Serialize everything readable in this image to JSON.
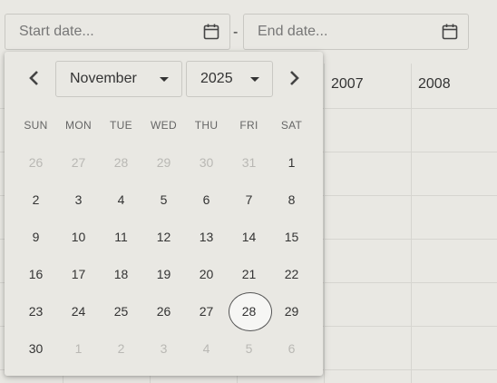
{
  "range": {
    "start_placeholder": "Start date...",
    "end_placeholder": "End date...",
    "separator": "-",
    "icon": "calendar-icon"
  },
  "table": {
    "headers": [
      "2007",
      "2008"
    ]
  },
  "calendar": {
    "month": "November",
    "year": "2025",
    "prev_icon": "chevron-left-icon",
    "next_icon": "chevron-right-icon",
    "weekdays": [
      "SUN",
      "MON",
      "TUE",
      "WED",
      "THU",
      "FRI",
      "SAT"
    ],
    "weeks": [
      [
        {
          "d": "26",
          "out": true
        },
        {
          "d": "27",
          "out": true
        },
        {
          "d": "28",
          "out": true
        },
        {
          "d": "29",
          "out": true
        },
        {
          "d": "30",
          "out": true
        },
        {
          "d": "31",
          "out": true
        },
        {
          "d": "1",
          "out": false
        }
      ],
      [
        {
          "d": "2",
          "out": false
        },
        {
          "d": "3",
          "out": false
        },
        {
          "d": "4",
          "out": false
        },
        {
          "d": "5",
          "out": false
        },
        {
          "d": "6",
          "out": false
        },
        {
          "d": "7",
          "out": false
        },
        {
          "d": "8",
          "out": false
        }
      ],
      [
        {
          "d": "9",
          "out": false
        },
        {
          "d": "10",
          "out": false
        },
        {
          "d": "11",
          "out": false
        },
        {
          "d": "12",
          "out": false
        },
        {
          "d": "13",
          "out": false
        },
        {
          "d": "14",
          "out": false
        },
        {
          "d": "15",
          "out": false
        }
      ],
      [
        {
          "d": "16",
          "out": false
        },
        {
          "d": "17",
          "out": false
        },
        {
          "d": "18",
          "out": false
        },
        {
          "d": "19",
          "out": false
        },
        {
          "d": "20",
          "out": false
        },
        {
          "d": "21",
          "out": false
        },
        {
          "d": "22",
          "out": false
        }
      ],
      [
        {
          "d": "23",
          "out": false
        },
        {
          "d": "24",
          "out": false
        },
        {
          "d": "25",
          "out": false
        },
        {
          "d": "26",
          "out": false
        },
        {
          "d": "27",
          "out": false
        },
        {
          "d": "28",
          "out": false,
          "selected": true
        },
        {
          "d": "29",
          "out": false
        }
      ],
      [
        {
          "d": "30",
          "out": false
        },
        {
          "d": "1",
          "out": true
        },
        {
          "d": "2",
          "out": true
        },
        {
          "d": "3",
          "out": true
        },
        {
          "d": "4",
          "out": true
        },
        {
          "d": "5",
          "out": true
        },
        {
          "d": "6",
          "out": true
        }
      ]
    ]
  },
  "colors": {
    "background": "#e9e8e3",
    "text": "#333333",
    "muted": "#b9b8b4",
    "selected_bg": "#f6f6f4"
  }
}
